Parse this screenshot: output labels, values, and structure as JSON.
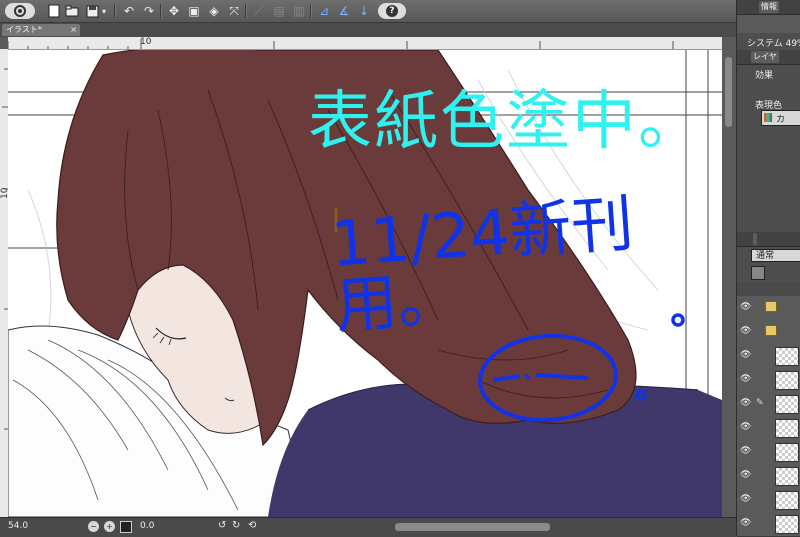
{
  "toolbar": {
    "icons": [
      "app-menu-icon",
      "new-file-icon",
      "open-file-icon",
      "save-icon",
      "undo-icon",
      "redo-icon",
      "transform-icon",
      "clear-icon",
      "fill-icon",
      "crop-icon",
      "ruler-icon",
      "select-all-icon",
      "pen-pressure-icon",
      "help-icon"
    ],
    "help_label": "?"
  },
  "document": {
    "tab_title": "イラスト*",
    "tab_close": "×",
    "ruler_top_label": "10",
    "ruler_left_label": "10"
  },
  "canvas": {
    "annotation_line1": "表紙色塗中。",
    "annotation_line2": "11/24新刊用。",
    "annotation_circle_text": "-.--",
    "colors": {
      "hair": "#6b3b3b",
      "hair_outline": "#3a1e1e",
      "skin": "#f3e5e0",
      "clothes": "#40386b",
      "pillow": "#fdfdfd",
      "cyan_text": "#2ef2f0",
      "blue_text": "#1033e8"
    }
  },
  "statusbar": {
    "zoom": "54.0",
    "angle": "0.0",
    "zoom_out_icon": "−",
    "zoom_in_icon": "+"
  },
  "right_panel": {
    "tab_info": "情報",
    "system_usage": "システム 49%",
    "layer_tab": "レイヤ",
    "effect_label": "効果",
    "display_color_label": "表現色",
    "display_color_value": "カ",
    "blend_mode": "通常",
    "layers": [
      {
        "type": "folder",
        "visible": true
      },
      {
        "type": "folder",
        "visible": true
      },
      {
        "type": "raster",
        "visible": true
      },
      {
        "type": "raster",
        "visible": true
      },
      {
        "type": "raster",
        "visible": true
      },
      {
        "type": "raster",
        "visible": true
      },
      {
        "type": "raster",
        "visible": true
      },
      {
        "type": "raster",
        "visible": true
      },
      {
        "type": "raster",
        "visible": true
      }
    ]
  }
}
